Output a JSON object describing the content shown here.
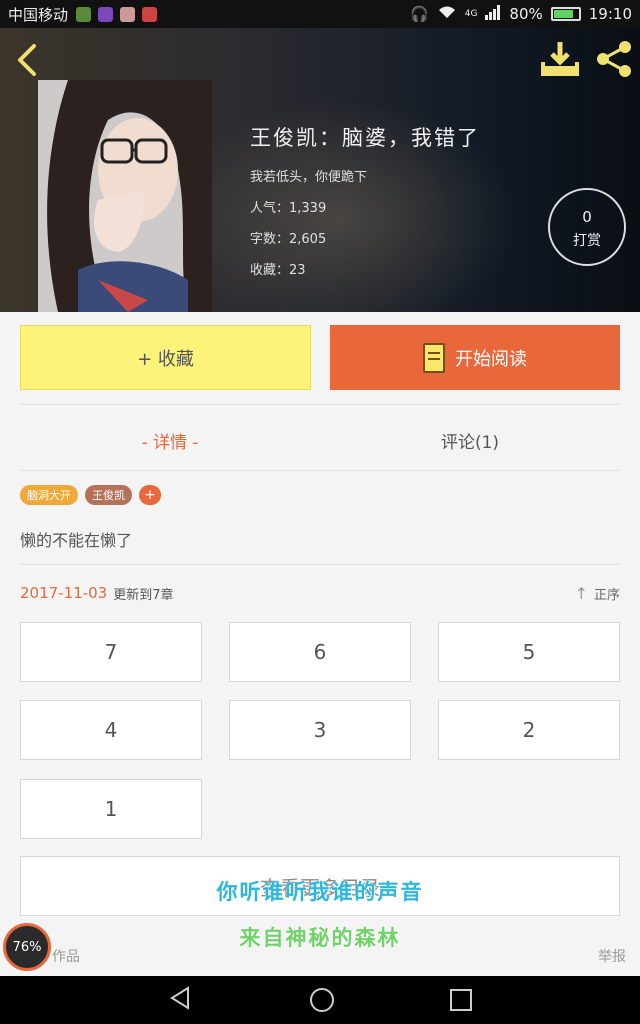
{
  "status_bar": {
    "carrier": "中国移动",
    "network": "4G",
    "battery": "80%",
    "battery_level": 0.8,
    "time": "19:10"
  },
  "header": {
    "book_title": "王俊凯：脑婆，我错了",
    "tagline": "我若低头，你便跪下",
    "popularity": "人气：1,339",
    "word_count": "字数：2,605",
    "collections": "收藏：23",
    "reward_count": "0",
    "reward_label": "打赏"
  },
  "actions": {
    "collect_label": "+ 收藏",
    "read_label": "开始阅读"
  },
  "tabs": {
    "detail": "- 详情 -",
    "comments": "评论(1)"
  },
  "tags": [
    {
      "label": "脑洞大开",
      "color": "#f0a83a"
    },
    {
      "label": "王俊凯",
      "color": "#b5715a"
    },
    {
      "label": "+",
      "color": "#e8683c"
    }
  ],
  "description": "懒的不能在懒了",
  "update": {
    "date": "2017-11-03",
    "text": "更新到7章",
    "order_label": "正序"
  },
  "chapters": [
    "7",
    "6",
    "5",
    "4",
    "3",
    "2",
    "1"
  ],
  "more_button": "查看更多目录",
  "lyrics": {
    "line1": "你听谁听我谁的声音",
    "line2": "来自神秘的森林"
  },
  "footer": {
    "author_works": "作品",
    "report": "举报"
  },
  "floating_badge": "76%",
  "colors": {
    "accent": "#e8683c",
    "collect_yellow": "#fdf27a",
    "lyric_blue": "#2ab8e0",
    "lyric_green": "#6fd36a"
  }
}
